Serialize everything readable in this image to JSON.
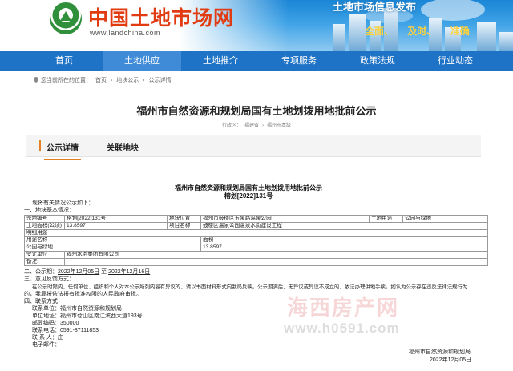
{
  "site": {
    "title": "中国土地市场网",
    "url": "www.landchina.com",
    "slogan_top": "土地市场信息发布",
    "slogan_items": [
      "全面、",
      "及时、",
      "准确"
    ]
  },
  "nav": {
    "items": [
      {
        "label": "首页"
      },
      {
        "label": "土地供应"
      },
      {
        "label": "土地推介"
      },
      {
        "label": "专项服务"
      },
      {
        "label": "政策法规"
      },
      {
        "label": "行业动态"
      }
    ],
    "active_index": 1
  },
  "breadcrumb": {
    "prefix": "您当前所在的位置：",
    "items": [
      "首页",
      "地块公示",
      "公示详情"
    ],
    "separator": "›"
  },
  "page": {
    "title": "福州市自然资源和规划局国有土地划拨用地批前公示",
    "region_label": "行政区：",
    "region": [
      "福建省",
      "福州市本级"
    ],
    "region_separator": "›"
  },
  "tabs": [
    {
      "label": "公示详情",
      "active": true
    },
    {
      "label": "关联地块",
      "active": false
    }
  ],
  "document": {
    "title": "福州市自然资源和规划局国有土地划拨用地批前公示",
    "code": "榕划[2022]131号",
    "intro": "现将有关情况公示如下：",
    "section1": "一、地块基本情况：",
    "table": {
      "row1": {
        "l1": "宗地编号",
        "v1": "榕划[2022]131号",
        "l2": "地块位置",
        "v2": "福州市鼓楼区玉泉路温泉公园",
        "l3": "土地用途",
        "v3": "公园与绿地"
      },
      "row2": {
        "l1": "土地面积(公顷)",
        "v1": "13.8597",
        "l2": "项目名称",
        "v2": "鼓楼区温泉公园温泉水街建设工程"
      },
      "row3": {
        "l1": "明细用途"
      },
      "row4": {
        "l1": "用途名称",
        "l2": "面积"
      },
      "row5": {
        "v1": "公园与绿地",
        "v2": "13.8597"
      },
      "row6": {
        "l1": "受让单位",
        "v1": "福州水务集团有限公司"
      },
      "row7": {
        "l1": "备注:"
      }
    },
    "section2_label": "二、公示期：",
    "period_start": "2022年12月05日",
    "period_to": "至",
    "period_end": "2022年12月16日",
    "section3": "三、意见反馈方式：",
    "feedback1": "在公示时限内，任何单位、组织和个人对本公示所列内容有异议的，请以书面材料形式向我局反映。公示期满后，无异议或异议不成立的，依法办理供地手续。如认为公示存在违反法律法规行为",
    "feedback2": "的，我局将依法报有批准权限的人民政府审批。",
    "section4": "四、联系方式",
    "contacts": [
      "联系单位：福州市自然资源和规划局",
      "单位地址：福州市仓山区南江滨西大道193号",
      "邮政编码：350000",
      "联系电话：0591-87111853",
      "联 系 人：庄",
      "电子邮件："
    ],
    "issuer": "福州市自然资源和规划局",
    "date": "2022年12月05日"
  },
  "watermark": {
    "name": "海西房产网",
    "url": "www.h0591.com"
  },
  "colors": {
    "nav_bg": "#1f73c6",
    "nav_active": "#3f8bd8",
    "title_red": "#e13b12",
    "tab_accent": "#e67e22"
  }
}
